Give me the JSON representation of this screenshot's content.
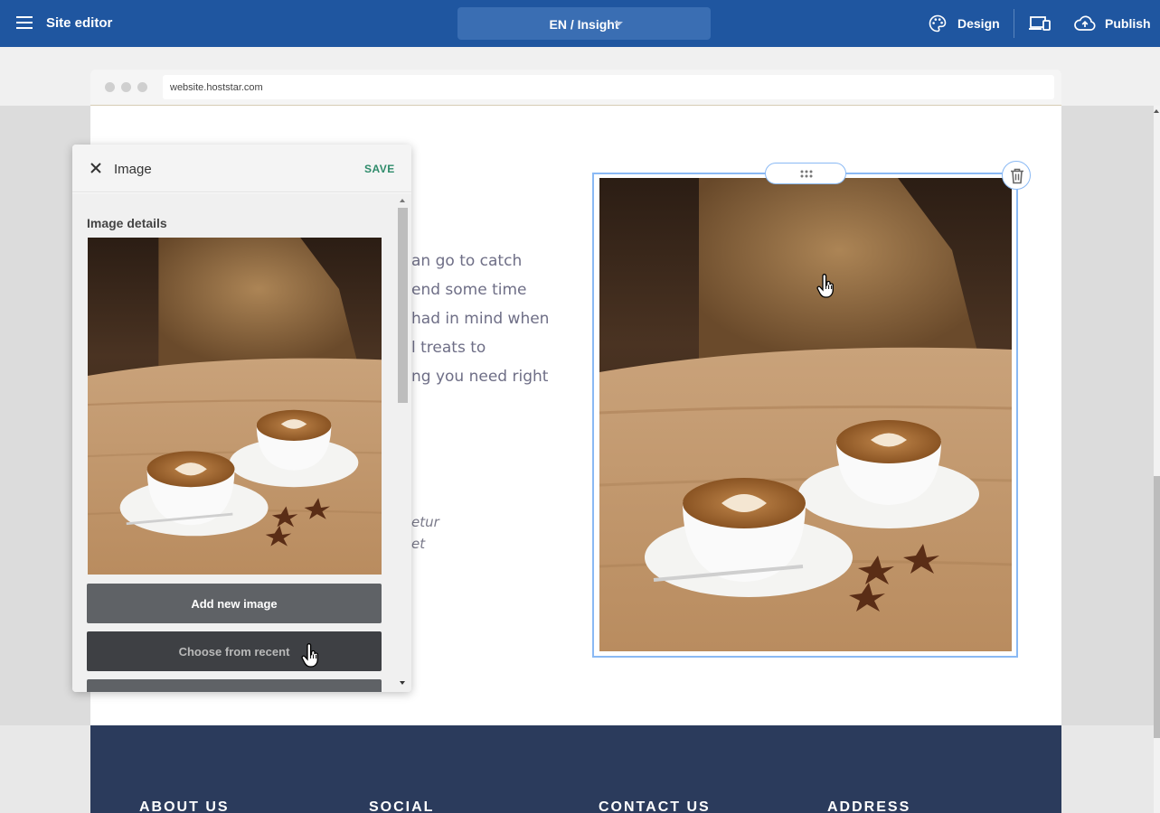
{
  "topbar": {
    "title": "Site editor",
    "language_selector": "EN / Insight",
    "design_label": "Design",
    "publish_label": "Publish"
  },
  "browser": {
    "url": "website.hoststar.com"
  },
  "page": {
    "body_lines": [
      "an go to catch",
      "end some time",
      "had in mind when",
      "l treats to",
      "ng you need right"
    ],
    "italic_lines": [
      "etur",
      "et"
    ],
    "footer_columns": [
      "ABOUT US",
      "SOCIAL",
      "CONTACT US",
      "ADDRESS"
    ]
  },
  "panel": {
    "title": "Image",
    "save_label": "SAVE",
    "section_heading": "Image details",
    "add_image_label": "Add new image",
    "choose_recent_label": "Choose from recent"
  },
  "icons": {
    "menu": "hamburger-icon",
    "language_caret": "caret-down-icon",
    "design": "palette-icon",
    "devices": "devices-icon",
    "publish": "cloud-upload-icon",
    "close": "close-icon",
    "drag": "drag-grip-icon",
    "delete": "trash-icon"
  },
  "colors": {
    "topbar": "#1f56a0",
    "selection": "#8ab9f4",
    "save": "#2e8b6a",
    "footer": "#2b3b5c"
  }
}
